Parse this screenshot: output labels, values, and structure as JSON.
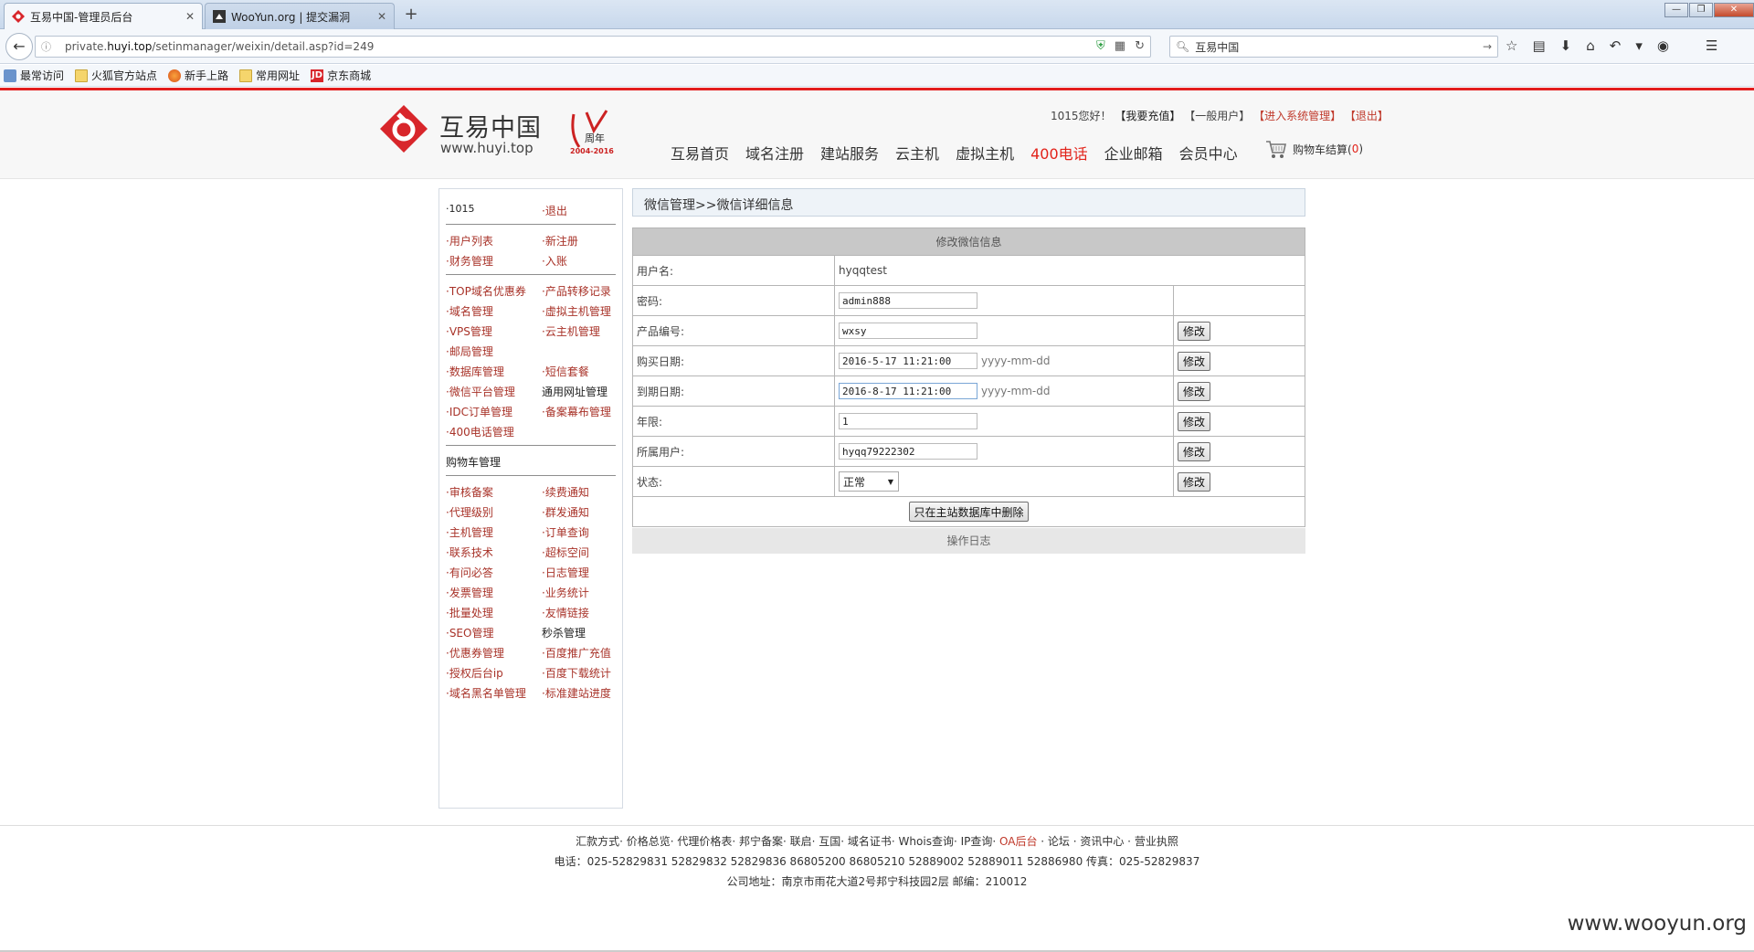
{
  "browser": {
    "tabs": [
      {
        "title": "互易中国-管理员后台",
        "active": true
      },
      {
        "title": "WooYun.org | 提交漏洞",
        "active": false
      }
    ],
    "url_prefix": "private.",
    "url_host": "huyi.top",
    "url_path": "/setinmanager/weixin/detail.asp?id=249",
    "search_text": "互易中国",
    "bookmarks": [
      "最常访问",
      "火狐官方站点",
      "新手上路",
      "常用网址",
      "京东商城"
    ]
  },
  "header": {
    "logo_cn": "互易中国",
    "logo_en": "www.huyi.top",
    "anniv_label": "周年",
    "anniv_years": "2004-2016",
    "greeting": "1015您好！",
    "recharge": "【我要充值】",
    "user_type": "【一般用户】",
    "enter_admin": "【进入系统管理】",
    "logout": "【退出】",
    "nav": [
      "互易首页",
      "域名注册",
      "建站服务",
      "云主机",
      "虚拟主机",
      "400电话",
      "企业邮箱",
      "会员中心"
    ],
    "cart_label": "购物车结算(",
    "cart_count": "0",
    "cart_close": ")"
  },
  "sidebar": {
    "rows": [
      {
        "a": "·1015",
        "b": "·退出"
      },
      {
        "a": "·用户列表",
        "b": "·新注册"
      },
      {
        "a": "·财务管理",
        "b": "·入账"
      },
      {
        "a": "·TOP域名优惠券",
        "b": "·产品转移记录"
      },
      {
        "a": "·域名管理",
        "b": "·虚拟主机管理"
      },
      {
        "a": "·VPS管理",
        "b": "·云主机管理"
      },
      {
        "a": "·邮局管理",
        "b": ""
      },
      {
        "a": "·数据库管理",
        "b": "·短信套餐"
      },
      {
        "a": "·微信平台管理",
        "b": "通用网址管理"
      },
      {
        "a": "·IDC订单管理",
        "b": "·备案幕布管理"
      },
      {
        "a": "·400电话管理",
        "b": ""
      },
      {
        "a": "购物车管理",
        "b": ""
      },
      {
        "a": "·审核备案",
        "b": "·续费通知"
      },
      {
        "a": "·代理级别",
        "b": "·群发通知"
      },
      {
        "a": "·主机管理",
        "b": "·订单查询"
      },
      {
        "a": "·联系技术",
        "b": "·超标空间"
      },
      {
        "a": "·有问必答",
        "b": "·日志管理"
      },
      {
        "a": "·发票管理",
        "b": "·业务统计"
      },
      {
        "a": "·批量处理",
        "b": "·友情链接"
      },
      {
        "a": "·SEO管理",
        "b": "秒杀管理"
      },
      {
        "a": "·优惠券管理",
        "b": "·百度推广充值"
      },
      {
        "a": "·授权后台ip",
        "b": "·百度下载统计"
      },
      {
        "a": "·域名黑名单管理",
        "b": "·标准建站进度"
      }
    ]
  },
  "main": {
    "breadcrumb": "微信管理>>微信详细信息",
    "table_title": "修改微信信息",
    "labels": {
      "username": "用户名:",
      "password": "密码:",
      "product_id": "产品编号:",
      "buy_date": "购买日期:",
      "expire_date": "到期日期:",
      "years": "年限:",
      "owner": "所属用户:",
      "status": "状态:"
    },
    "values": {
      "username": "hyqqtest",
      "password": "admin888",
      "product_id": "wxsy",
      "buy_date": "2016-5-17 11:21:00",
      "expire_date": "2016-8-17 11:21:00",
      "years": "1",
      "owner": "hyqq79222302",
      "status": "正常"
    },
    "date_format": "yyyy-mm-dd",
    "modify_label": "修改",
    "delete_label": "只在主站数据库中删除",
    "log_label": "操作日志"
  },
  "footer": {
    "links_before_oa": "汇款方式· 价格总览· 代理价格表· 邦宁备案· 联启· 互国· 域名证书· Whois查询· IP查询·",
    "oa": "OA后台",
    "links_after_oa": "· 论坛 · 资讯中心 · 营业执照",
    "phone": "电话：025-52829831 52829832 52829836 86805200 86805210 52889002 52889011 52886980   传真：025-52829837",
    "address": "公司地址：南京市雨花大道2号邦宁科技园2层 邮编：210012"
  },
  "watermark": "www.wooyun.org",
  "colors": {
    "accent_red": "#e21d1d",
    "link_red": "#a83228"
  }
}
